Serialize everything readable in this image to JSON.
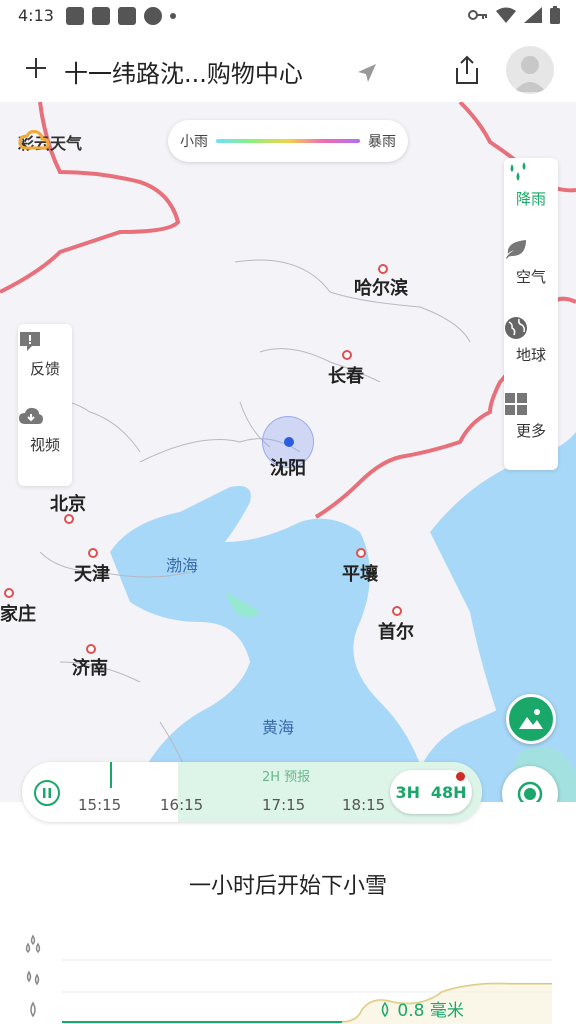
{
  "status_bar": {
    "time": "4:13"
  },
  "header": {
    "location_title": "十一纬路沈...购物中心"
  },
  "map": {
    "brand": "彩云天气",
    "legend": {
      "left_label": "小雨",
      "right_label": "暴雨"
    },
    "left_panel": [
      {
        "label": "反馈",
        "icon": "feedback-icon"
      },
      {
        "label": "视频",
        "icon": "video-download-icon"
      }
    ],
    "right_panel": [
      {
        "label": "降雨",
        "icon": "rain-icon"
      },
      {
        "label": "空气",
        "icon": "leaf-icon"
      },
      {
        "label": "地球",
        "icon": "globe-icon"
      },
      {
        "label": "更多",
        "icon": "grid-icon"
      }
    ],
    "cities": [
      {
        "name": "哈尔滨"
      },
      {
        "name": "长春"
      },
      {
        "name": "沈阳"
      },
      {
        "name": "北京"
      },
      {
        "name": "天津"
      },
      {
        "name": "平壤"
      },
      {
        "name": "首尔"
      },
      {
        "name": "济南"
      },
      {
        "name": "家庄"
      }
    ],
    "seas": [
      {
        "name": "渤海"
      },
      {
        "name": "黄海"
      }
    ]
  },
  "timeline": {
    "ticks": [
      "15:15",
      "16:15",
      "17:15",
      "18:15"
    ],
    "forecast_label": "2H 预报",
    "range_options": [
      "3H",
      "48H"
    ],
    "selected_range": "48H"
  },
  "bottom": {
    "summary": "一小时后开始下小雪",
    "precip_reading": "0.8 毫米"
  },
  "colors": {
    "accent": "#1aa86a",
    "border_red": "#e8707a",
    "sea": "#a8d8f8"
  }
}
